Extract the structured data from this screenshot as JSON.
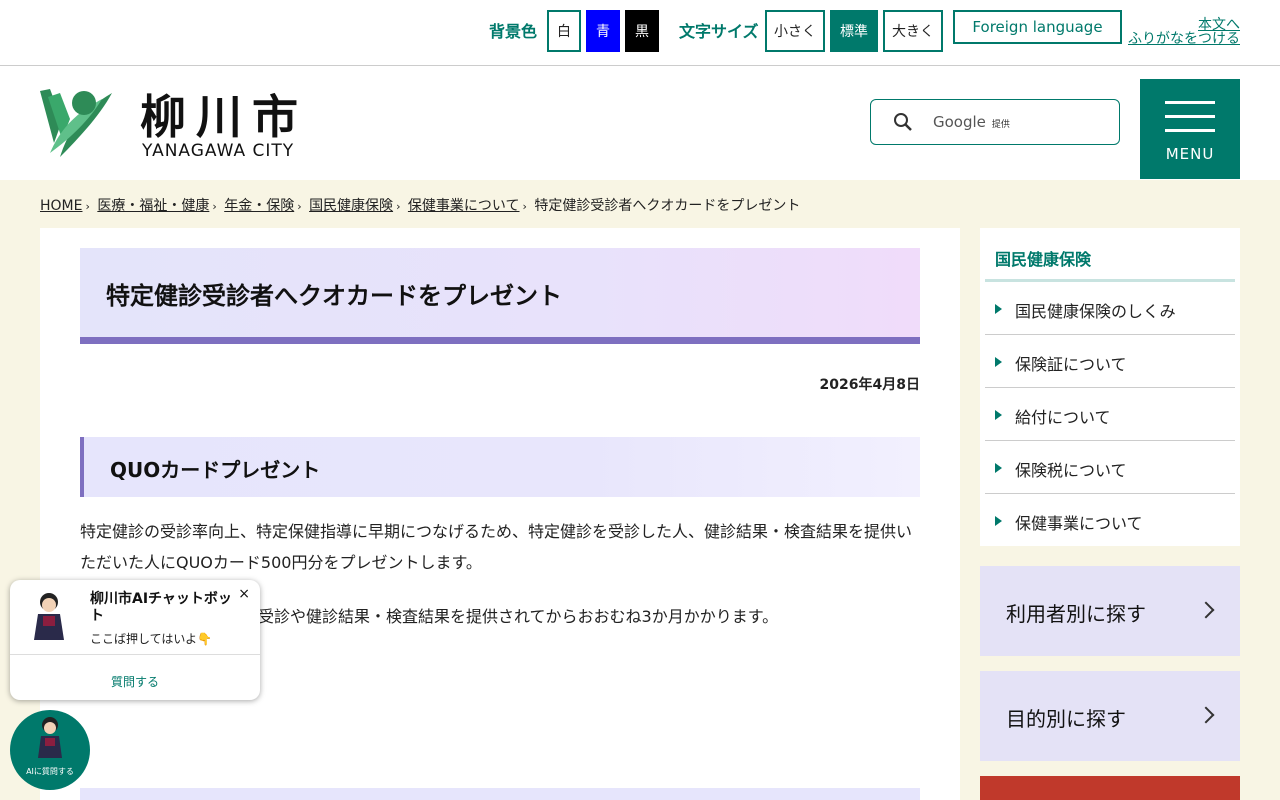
{
  "utility": {
    "bg_label": "背景色",
    "bg_white": "白",
    "bg_blue": "青",
    "bg_black": "黒",
    "font_label": "文字サイズ",
    "font_small": "小さく",
    "font_standard": "標準",
    "font_large": "大きく",
    "foreign": "Foreign language",
    "read_aloud": "本文へ",
    "furigana": "ふりがなをつける"
  },
  "header": {
    "logo_kanji": "柳川市",
    "logo_roman": "YANAGAWA CITY",
    "search_brand": "Google",
    "search_provided": "提供",
    "menu_label": "MENU"
  },
  "breadcrumb": {
    "items": [
      "HOME",
      "医療・福祉・健康",
      "年金・保険",
      "国民健康保険",
      "保健事業について"
    ],
    "current": "特定健診受診者へクオカードをプレゼント"
  },
  "article": {
    "title": "特定健診受診者へクオカードをプレゼント",
    "date": "2026年4月8日",
    "section_heading": "QUOカードプレゼント",
    "para1": "特定健診の受診率向上、特定保健指導に早期につなげるため、特定健診を受診した人、健診結果・検査結果を提供いただいた人にQUOカード500円分をプレゼントします。",
    "para2": "受診や健診結果・検査結果を提供されてからおおむね3か月かかります。"
  },
  "sidenav": {
    "heading": "国民健康保険",
    "items": [
      "国民健康保険のしくみ",
      "保険証について",
      "給付について",
      "保険税について",
      "保健事業について"
    ]
  },
  "find": {
    "by_user": "利用者別に探す",
    "by_purpose": "目的別に探す"
  },
  "chat": {
    "title": "柳川市AIチャットボット",
    "subtitle": "ここば押してはいよ👇",
    "close": "×",
    "ask": "質問する",
    "fab_label": "AIに質問する"
  },
  "colors": {
    "brand": "#00796b",
    "accent_purple": "#7e6fc0",
    "cream": "#f8f5e4"
  }
}
